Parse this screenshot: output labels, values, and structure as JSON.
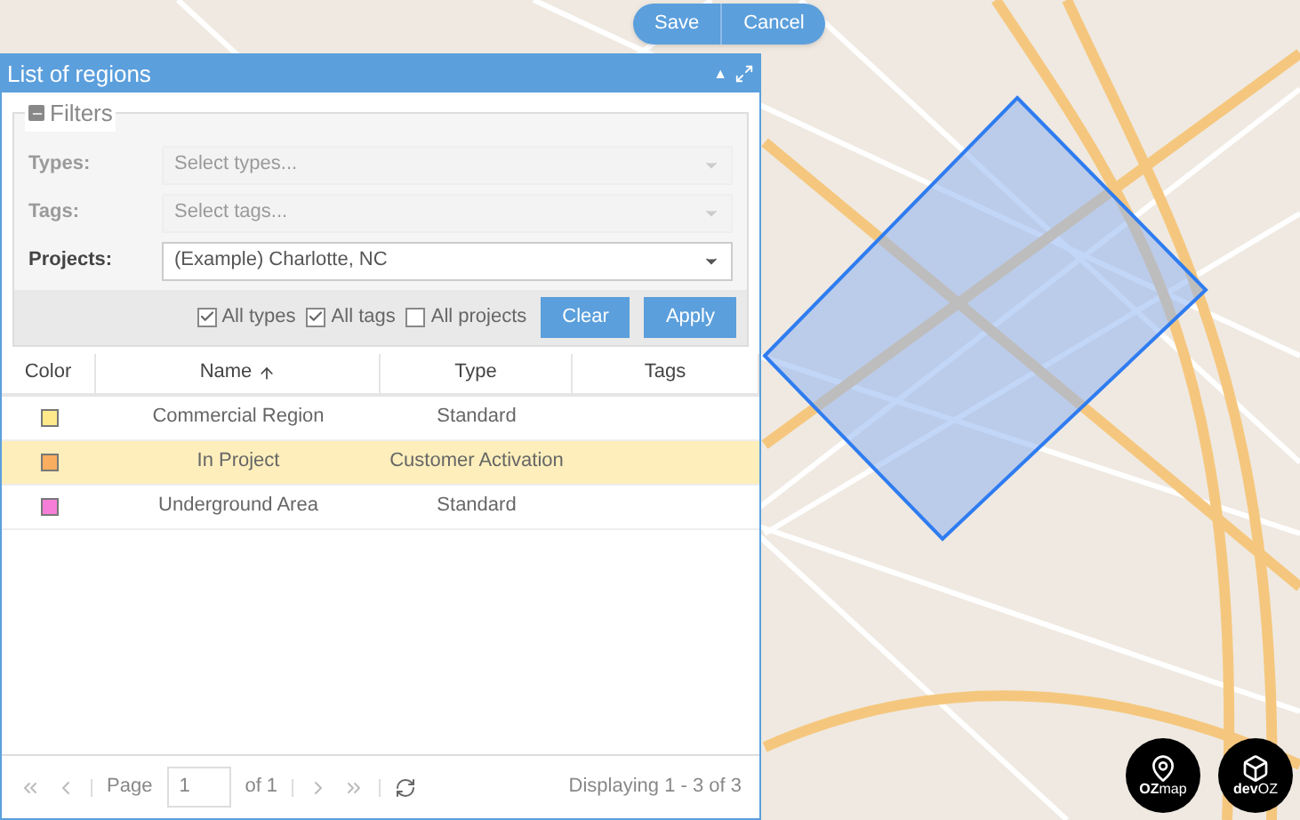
{
  "toolbar": {
    "buttons": [
      "Save",
      "Cancel"
    ]
  },
  "panel": {
    "title": "List of regions",
    "collapse_icon": "▲",
    "filters": {
      "legend": "Filters",
      "expanded": true,
      "fields": [
        {
          "label": "Types:",
          "placeholder": "Select types...",
          "disabled": true
        },
        {
          "label": "Tags:",
          "placeholder": "Select tags...",
          "disabled": true
        },
        {
          "label": "Projects:",
          "value": "(Example) Charlotte, NC",
          "disabled": false
        }
      ],
      "checkboxes": [
        {
          "label": "All types",
          "checked": true
        },
        {
          "label": "All tags",
          "checked": true
        },
        {
          "label": "All projects",
          "checked": false
        }
      ],
      "buttons": [
        "Clear",
        "Apply"
      ]
    },
    "table": {
      "columns": [
        {
          "label": "Color",
          "sorted": false
        },
        {
          "label": "Name",
          "sorted": true
        },
        {
          "label": "Type",
          "sorted": false
        },
        {
          "label": "Tags",
          "sorted": false
        }
      ],
      "rows": [
        {
          "color": "#ffe98a",
          "name": "Commercial Region",
          "type": "Standard",
          "selected": false
        },
        {
          "color": "#f9ad5e",
          "name": "In Project",
          "type": "Customer Activation",
          "selected": true
        },
        {
          "color": "#f77ed8",
          "name": "Underground Area",
          "type": "Standard",
          "selected": false
        }
      ]
    },
    "pager": {
      "page_label": "Page",
      "page": "1",
      "of": "of 1",
      "display": "Displaying 1 - 3 of 3"
    }
  },
  "logos": [
    {
      "prefix": "OZ",
      "suffix": "map",
      "kind": "pin"
    },
    {
      "prefix": "dev",
      "suffix": "OZ",
      "kind": "box"
    }
  ]
}
